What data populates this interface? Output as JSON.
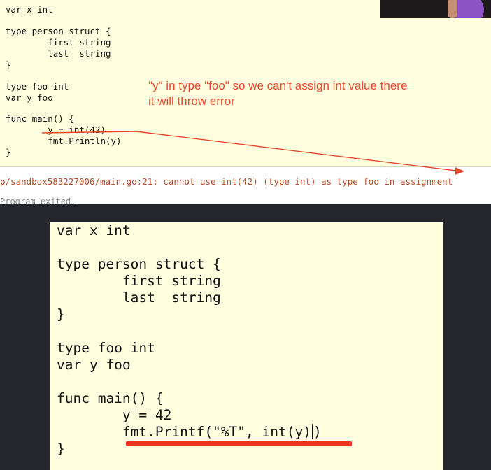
{
  "top_panel": {
    "code_blocks": [
      "var x int",
      "type person struct {\n        first string\n        last  string\n}",
      "type foo int\nvar y foo",
      "func main() {\n        y = int(42)\n        fmt.Println(y)\n}"
    ],
    "annotation": {
      "line1": "\"y\" in type \"foo\" so we can't assign int value there",
      "line2": "it will throw error",
      "color": "#f0452c"
    },
    "error_message": "p/sandbox583227006/main.go:21: cannot use int(42) (type int) as type foo in assignment",
    "program_exited": "Program exited."
  },
  "bottom_panel": {
    "code_blocks": [
      "var x int",
      "type person struct {\n        first string\n        last  string\n}",
      "type foo int\nvar y foo",
      "func main() {\n        y = 42"
    ],
    "printf_line": "        fmt.Printf(\"%T\", int(y)",
    "printf_close": ")",
    "closing_brace": "}",
    "underline_color": "#ee3420"
  }
}
